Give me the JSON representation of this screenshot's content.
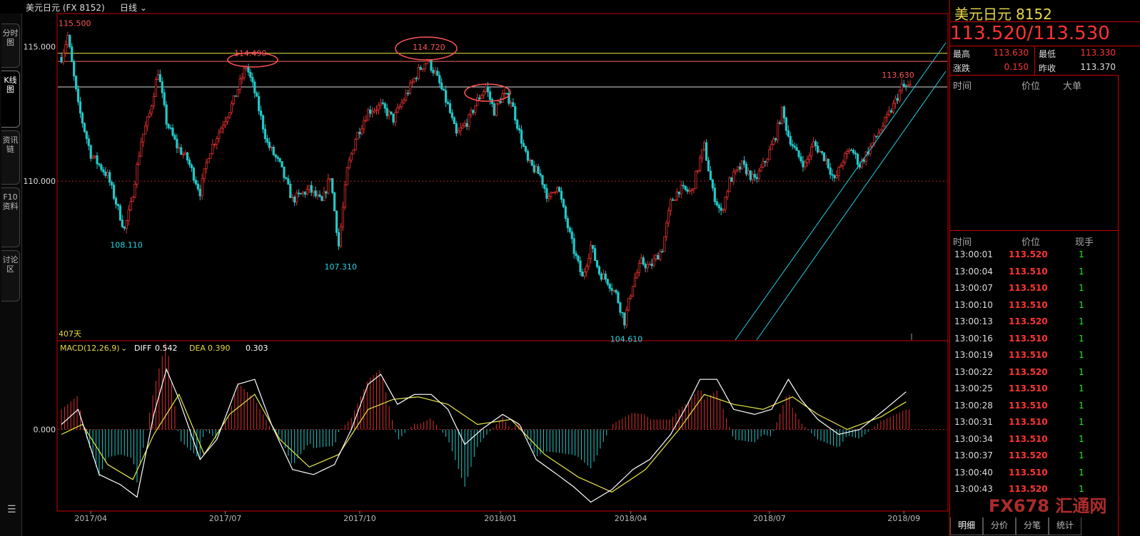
{
  "toolbar": {
    "symbol_title": "美元日元 (FX 8152)",
    "period": "日线"
  },
  "nav_tabs": [
    "分时图",
    "K线图",
    "资讯链",
    "F10资料",
    "讨论区"
  ],
  "quote": {
    "name": "美元日元",
    "code": "8152",
    "bid_ask": "113.520/113.530",
    "high_label": "最高",
    "high": "113.630",
    "low_label": "最低",
    "low": "113.330",
    "change_label": "涨跌",
    "change": "0.150",
    "prev_close_label": "昨收",
    "prev_close": "113.370",
    "bigorder_headers": [
      "时间",
      "价位",
      "大单"
    ],
    "tick_headers": [
      "时间",
      "价位",
      "现手"
    ],
    "ticks": [
      {
        "time": "13:00:01",
        "price": "113.520",
        "qty": "1"
      },
      {
        "time": "13:00:04",
        "price": "113.510",
        "qty": "1"
      },
      {
        "time": "13:00:07",
        "price": "113.510",
        "qty": "1"
      },
      {
        "time": "13:00:10",
        "price": "113.510",
        "qty": "1"
      },
      {
        "time": "13:00:13",
        "price": "113.520",
        "qty": "1"
      },
      {
        "time": "13:00:16",
        "price": "113.510",
        "qty": "1"
      },
      {
        "time": "13:00:19",
        "price": "113.510",
        "qty": "1"
      },
      {
        "time": "13:00:22",
        "price": "113.520",
        "qty": "1"
      },
      {
        "time": "13:00:25",
        "price": "113.510",
        "qty": "1"
      },
      {
        "time": "13:00:28",
        "price": "113.510",
        "qty": "1"
      },
      {
        "time": "13:00:31",
        "price": "113.510",
        "qty": "1"
      },
      {
        "time": "13:00:34",
        "price": "113.510",
        "qty": "1"
      },
      {
        "time": "13:00:37",
        "price": "113.520",
        "qty": "1"
      },
      {
        "time": "13:00:40",
        "price": "113.510",
        "qty": "1"
      },
      {
        "time": "13:00:43",
        "price": "113.520",
        "qty": "1"
      }
    ],
    "bottom_tabs": [
      "明细",
      "分价",
      "分笔",
      "统计"
    ]
  },
  "watermark": "FX678 汇通网",
  "colors": {
    "up": "#e03030",
    "down": "#22c8c8",
    "accent": "#e8d84a",
    "border": "#cc0000"
  },
  "chart_data": {
    "type": "candlestick",
    "price_ticks": [
      115.0,
      110.0
    ],
    "price_tick_labels": [
      "115.000",
      "110.000"
    ],
    "ylim": [
      104.1,
      116.2
    ],
    "x_tick_labels": [
      "2017/04",
      "2017/07",
      "2017/10",
      "2018/01",
      "2018/04",
      "2018/07",
      "2018/09"
    ],
    "x_tick_index": [
      14,
      78,
      142,
      209,
      271,
      337,
      401
    ],
    "x_count": 406,
    "window_label": "407天",
    "horizontal_levels": [
      {
        "price": 114.75,
        "color": "#e8e84a"
      },
      {
        "price": 114.45,
        "color": "#ff6666"
      },
      {
        "price": 113.5,
        "color": "#dddddd"
      },
      {
        "price": 110.0,
        "color": "#aa2222",
        "style": "dotted"
      }
    ],
    "key_points": [
      {
        "idx": 2,
        "price": 115.5,
        "label": "115.500"
      },
      {
        "idx": 89,
        "price": 114.49,
        "label": "114.490"
      },
      {
        "idx": 174,
        "price": 114.72,
        "label": "114.720"
      },
      {
        "idx": 30,
        "price": 108.11,
        "label": "108.110"
      },
      {
        "idx": 132,
        "price": 107.31,
        "label": "107.310"
      },
      {
        "idx": 268,
        "price": 104.61,
        "label": "104.610"
      },
      {
        "idx": 400,
        "price": 113.63,
        "label": "113.630"
      }
    ],
    "path": [
      [
        0,
        114.6
      ],
      [
        3,
        115.4
      ],
      [
        8,
        112.8
      ],
      [
        14,
        111.0
      ],
      [
        22,
        110.2
      ],
      [
        30,
        108.2
      ],
      [
        33,
        109.1
      ],
      [
        38,
        111.5
      ],
      [
        42,
        112.5
      ],
      [
        46,
        114.1
      ],
      [
        50,
        112.2
      ],
      [
        55,
        111.3
      ],
      [
        60,
        110.8
      ],
      [
        66,
        109.6
      ],
      [
        70,
        111.0
      ],
      [
        76,
        112.0
      ],
      [
        82,
        113.0
      ],
      [
        88,
        114.3
      ],
      [
        92,
        113.3
      ],
      [
        98,
        111.4
      ],
      [
        104,
        110.6
      ],
      [
        110,
        109.3
      ],
      [
        118,
        109.7
      ],
      [
        124,
        109.2
      ],
      [
        128,
        110.2
      ],
      [
        132,
        107.6
      ],
      [
        136,
        110.4
      ],
      [
        140,
        111.6
      ],
      [
        146,
        112.6
      ],
      [
        152,
        112.8
      ],
      [
        158,
        112.3
      ],
      [
        164,
        113.2
      ],
      [
        170,
        114.1
      ],
      [
        174,
        114.5
      ],
      [
        178,
        114.0
      ],
      [
        184,
        112.8
      ],
      [
        188,
        111.7
      ],
      [
        194,
        112.3
      ],
      [
        198,
        113.0
      ],
      [
        202,
        113.5
      ],
      [
        206,
        112.6
      ],
      [
        210,
        113.2
      ],
      [
        214,
        113.0
      ],
      [
        218,
        111.8
      ],
      [
        222,
        110.7
      ],
      [
        228,
        110.2
      ],
      [
        232,
        109.3
      ],
      [
        236,
        109.9
      ],
      [
        240,
        108.6
      ],
      [
        244,
        107.4
      ],
      [
        248,
        106.4
      ],
      [
        252,
        107.6
      ],
      [
        256,
        106.6
      ],
      [
        260,
        106.3
      ],
      [
        264,
        105.8
      ],
      [
        268,
        104.8
      ],
      [
        272,
        106.2
      ],
      [
        276,
        107.0
      ],
      [
        280,
        106.8
      ],
      [
        286,
        107.5
      ],
      [
        290,
        109.2
      ],
      [
        294,
        109.7
      ],
      [
        300,
        109.6
      ],
      [
        304,
        110.8
      ],
      [
        306,
        111.3
      ],
      [
        310,
        109.6
      ],
      [
        314,
        108.8
      ],
      [
        318,
        110.0
      ],
      [
        324,
        110.6
      ],
      [
        330,
        110.0
      ],
      [
        336,
        110.9
      ],
      [
        340,
        111.7
      ],
      [
        343,
        112.6
      ],
      [
        346,
        111.7
      ],
      [
        350,
        111.0
      ],
      [
        354,
        110.6
      ],
      [
        358,
        111.4
      ],
      [
        364,
        110.8
      ],
      [
        368,
        110.0
      ],
      [
        372,
        110.8
      ],
      [
        376,
        111.2
      ],
      [
        380,
        110.6
      ],
      [
        386,
        111.4
      ],
      [
        392,
        112.2
      ],
      [
        396,
        112.8
      ],
      [
        400,
        113.5
      ]
    ],
    "channel": [
      {
        "from": [
          1030,
          477
        ],
        "to": [
          1325,
          60
        ]
      },
      {
        "from": [
          1060,
          477
        ],
        "to": [
          1325,
          100
        ]
      }
    ],
    "macd": {
      "label": "MACD(12,26,9)",
      "diff_label": "DIFF",
      "diff": "0.542",
      "dea_label": "DEA",
      "dea": "0.390",
      "macd_value": "0.303",
      "zero_label": "0.000",
      "ylim": [
        -1.6,
        1.5
      ],
      "diff_path": [
        [
          0,
          0.1
        ],
        [
          8,
          0.4
        ],
        [
          18,
          -0.9
        ],
        [
          28,
          -1.1
        ],
        [
          36,
          -1.35
        ],
        [
          44,
          0.3
        ],
        [
          50,
          1.2
        ],
        [
          56,
          0.6
        ],
        [
          66,
          -0.6
        ],
        [
          74,
          -0.2
        ],
        [
          84,
          0.9
        ],
        [
          92,
          1.0
        ],
        [
          100,
          0.1
        ],
        [
          110,
          -0.8
        ],
        [
          120,
          -0.9
        ],
        [
          130,
          -0.7
        ],
        [
          138,
          0.0
        ],
        [
          146,
          0.9
        ],
        [
          152,
          1.1
        ],
        [
          160,
          0.5
        ],
        [
          168,
          0.7
        ],
        [
          176,
          0.7
        ],
        [
          184,
          0.4
        ],
        [
          192,
          -0.3
        ],
        [
          200,
          0.0
        ],
        [
          210,
          0.3
        ],
        [
          218,
          0.1
        ],
        [
          226,
          -0.6
        ],
        [
          236,
          -0.9
        ],
        [
          244,
          -1.15
        ],
        [
          252,
          -1.45
        ],
        [
          262,
          -1.2
        ],
        [
          272,
          -0.8
        ],
        [
          280,
          -0.6
        ],
        [
          290,
          -0.1
        ],
        [
          298,
          0.5
        ],
        [
          304,
          1.0
        ],
        [
          312,
          1.0
        ],
        [
          320,
          0.4
        ],
        [
          330,
          0.3
        ],
        [
          338,
          0.4
        ],
        [
          346,
          1.0
        ],
        [
          352,
          0.6
        ],
        [
          360,
          0.2
        ],
        [
          370,
          -0.1
        ],
        [
          380,
          0.0
        ],
        [
          392,
          0.4
        ],
        [
          402,
          0.75
        ]
      ],
      "dea_path": [
        [
          0,
          -0.1
        ],
        [
          10,
          0.1
        ],
        [
          22,
          -0.7
        ],
        [
          34,
          -1.0
        ],
        [
          44,
          -0.1
        ],
        [
          56,
          0.7
        ],
        [
          68,
          -0.5
        ],
        [
          80,
          0.3
        ],
        [
          92,
          0.7
        ],
        [
          104,
          -0.2
        ],
        [
          118,
          -0.75
        ],
        [
          132,
          -0.5
        ],
        [
          146,
          0.4
        ],
        [
          158,
          0.6
        ],
        [
          170,
          0.65
        ],
        [
          184,
          0.5
        ],
        [
          198,
          0.1
        ],
        [
          214,
          0.2
        ],
        [
          230,
          -0.5
        ],
        [
          246,
          -0.95
        ],
        [
          262,
          -1.25
        ],
        [
          278,
          -0.8
        ],
        [
          294,
          0.0
        ],
        [
          306,
          0.7
        ],
        [
          320,
          0.5
        ],
        [
          334,
          0.4
        ],
        [
          348,
          0.65
        ],
        [
          360,
          0.3
        ],
        [
          374,
          0.0
        ],
        [
          390,
          0.25
        ],
        [
          402,
          0.55
        ]
      ]
    }
  }
}
